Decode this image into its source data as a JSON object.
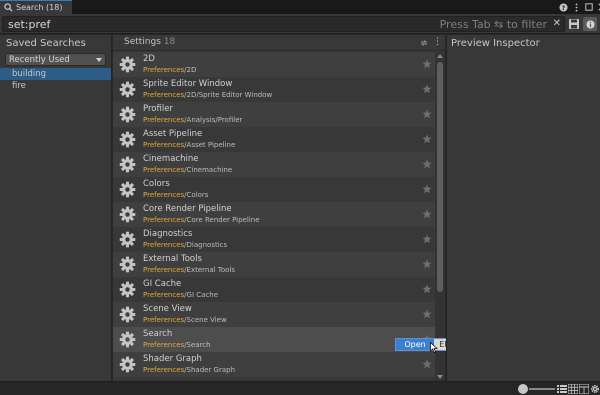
{
  "window": {
    "tab_title": "Search (18)"
  },
  "titlebar_icons": [
    "help-icon",
    "more-vertical-icon",
    "maximize-icon",
    "close-icon"
  ],
  "search": {
    "query": "set:pref",
    "hint": "Press Tab ⇆ to filter",
    "clear_glyph": "✕"
  },
  "saved_searches": {
    "title": "Saved Searches",
    "dropdown_value": "Recently Used",
    "items": [
      {
        "label": "building",
        "selected": true
      },
      {
        "label": "fire",
        "selected": false
      }
    ]
  },
  "results_header": {
    "label": "Settings",
    "count": "18"
  },
  "results": [
    {
      "name": "2D",
      "prefix": "Preferences",
      "rest": "/2D"
    },
    {
      "name": "Sprite Editor Window",
      "prefix": "Preferences",
      "rest": "/2D/Sprite Editor Window"
    },
    {
      "name": "Profiler",
      "prefix": "Preferences",
      "rest": "/Analysis/Profiler"
    },
    {
      "name": "Asset Pipeline",
      "prefix": "Preferences",
      "rest": "/Asset Pipeline"
    },
    {
      "name": "Cinemachine",
      "prefix": "Preferences",
      "rest": "/Cinemachine"
    },
    {
      "name": "Colors",
      "prefix": "Preferences",
      "rest": "/Colors"
    },
    {
      "name": "Core Render Pipeline",
      "prefix": "Preferences",
      "rest": "/Core Render Pipeline"
    },
    {
      "name": "Diagnostics",
      "prefix": "Preferences",
      "rest": "/Diagnostics"
    },
    {
      "name": "External Tools",
      "prefix": "Preferences",
      "rest": "/External Tools"
    },
    {
      "name": "GI Cache",
      "prefix": "Preferences",
      "rest": "/GI Cache"
    },
    {
      "name": "Scene View",
      "prefix": "Preferences",
      "rest": "/Scene View"
    },
    {
      "name": "Search",
      "prefix": "Preferences",
      "rest": "/Search"
    },
    {
      "name": "Shader Graph",
      "prefix": "Preferences",
      "rest": "/Shader Graph"
    }
  ],
  "action_popup": {
    "open_label": "Open",
    "key_label": "ENTER"
  },
  "preview": {
    "title": "Preview Inspector"
  },
  "colors": {
    "selection": "#2c5d87",
    "path_prefix": "#e2ab3b",
    "action_highlight": "#3a7fd0"
  }
}
